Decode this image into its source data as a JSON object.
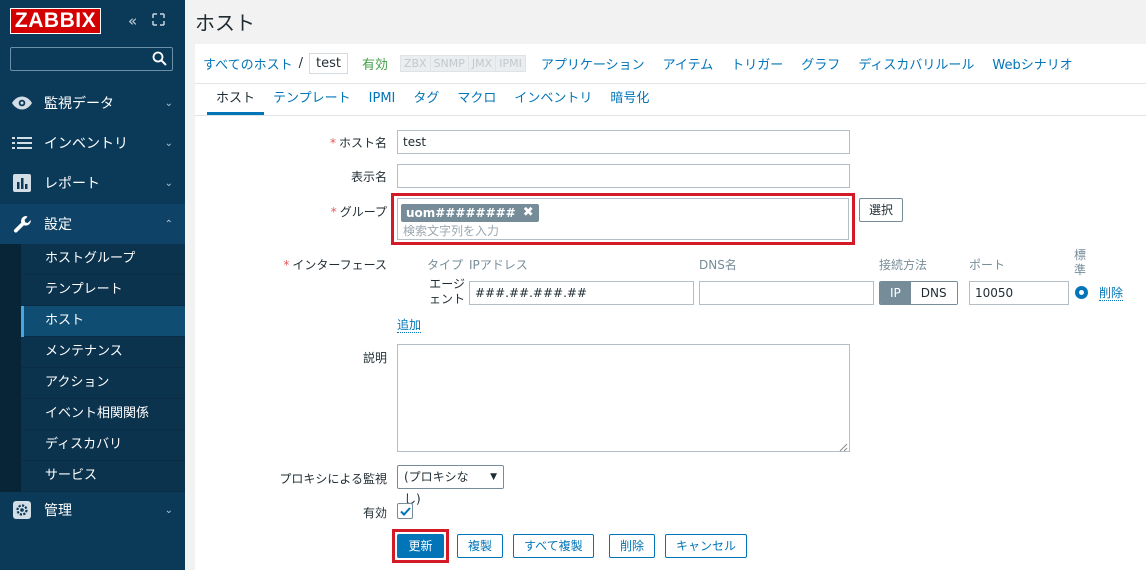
{
  "app": {
    "logo": "ZABBIX"
  },
  "sidebar": {
    "search_placeholder": "",
    "sections": [
      {
        "label": "監視データ",
        "icon": "eye-icon"
      },
      {
        "label": "インベントリ",
        "icon": "list-icon"
      },
      {
        "label": "レポート",
        "icon": "bar-chart-icon"
      },
      {
        "label": "設定",
        "icon": "wrench-icon"
      },
      {
        "label": "管理",
        "icon": "gear-icon"
      }
    ],
    "submenu": [
      "ホストグループ",
      "テンプレート",
      "ホスト",
      "メンテナンス",
      "アクション",
      "イベント相関関係",
      "ディスカバリ",
      "サービス"
    ]
  },
  "page": {
    "title": "ホスト"
  },
  "breadcrumb": {
    "all_hosts": "すべてのホスト",
    "separator": "/",
    "current": "test",
    "enabled": "有効",
    "availability": [
      "ZBX",
      "SNMP",
      "JMX",
      "IPMI"
    ],
    "links": [
      "アプリケーション",
      "アイテム",
      "トリガー",
      "グラフ",
      "ディスカバリルール",
      "Webシナリオ"
    ]
  },
  "tabs": [
    "ホスト",
    "テンプレート",
    "IPMI",
    "タグ",
    "マクロ",
    "インベントリ",
    "暗号化"
  ],
  "form": {
    "required_mark": "*",
    "host_name_label": "ホスト名",
    "host_name_value": "test",
    "visible_name_label": "表示名",
    "visible_name_value": "",
    "groups_label": "グループ",
    "group_tag": "uom########",
    "groups_placeholder": "検索文字列を入力",
    "select_button": "選択",
    "interfaces_label": "インターフェース",
    "iface_headers": {
      "type": "タイプ",
      "ip": "IPアドレス",
      "dns": "DNS名",
      "connect": "接続方法",
      "port": "ポート",
      "default": "標準"
    },
    "iface_type": "エージェント",
    "iface_ip": "###.##.###.##",
    "iface_dns": "",
    "connect_ip": "IP",
    "connect_dns": "DNS",
    "iface_port": "10050",
    "remove_link": "削除",
    "add_link": "追加",
    "description_label": "説明",
    "proxy_label": "プロキシによる監視",
    "proxy_value": "(プロキシなし)",
    "enabled_label": "有効",
    "enabled_checked": true
  },
  "buttons": {
    "update": "更新",
    "clone": "複製",
    "full_clone": "すべて複製",
    "delete": "削除",
    "cancel": "キャンセル"
  },
  "colors": {
    "sidebar": "#0b3a59",
    "accent": "#0275b8",
    "highlight": "#d31a26",
    "logo": "#d40000"
  }
}
